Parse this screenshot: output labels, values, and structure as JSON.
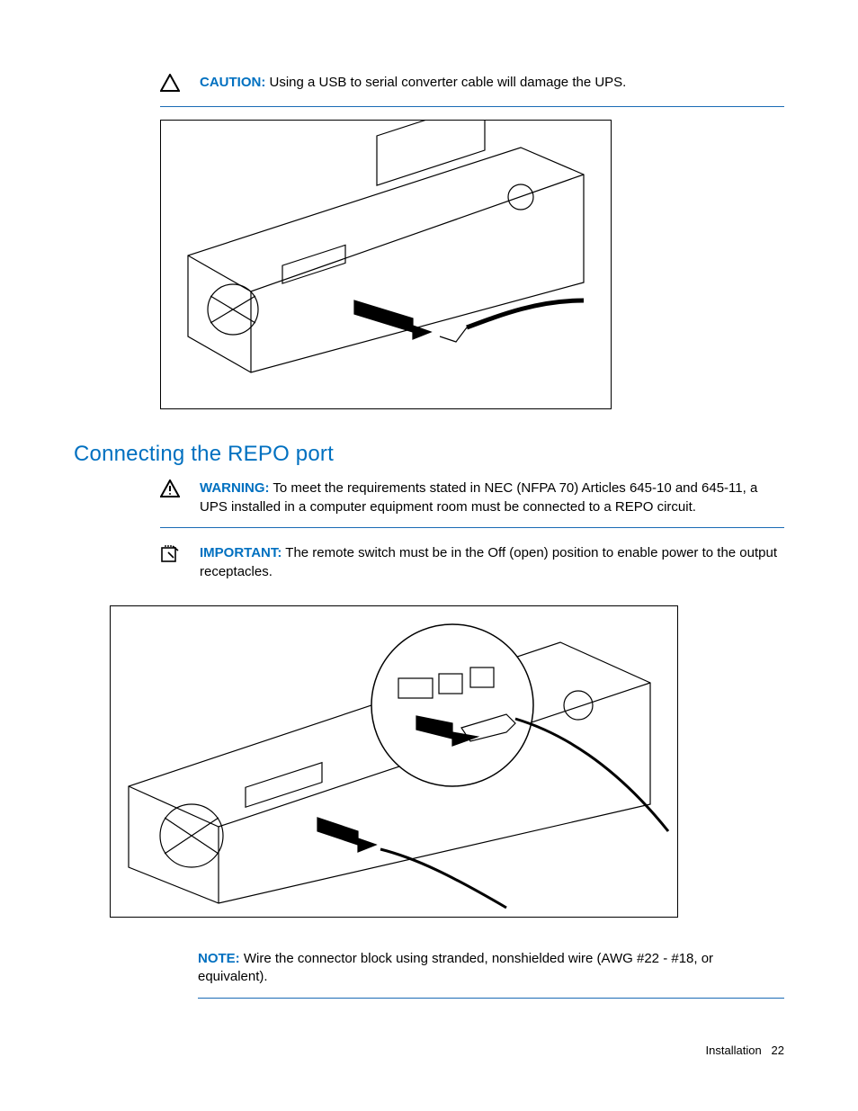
{
  "caution": {
    "label": "CAUTION:",
    "text": "Using a USB to serial converter cable will damage the UPS."
  },
  "heading": "Connecting the REPO port",
  "warning": {
    "label": "WARNING:",
    "text": "To meet the requirements stated in NEC (NFPA 70) Articles 645-10 and 645-11, a UPS installed in a computer equipment room must be connected to a REPO circuit."
  },
  "important": {
    "label": "IMPORTANT:",
    "text": "The remote switch must be in the Off (open) position to enable power to the output receptacles."
  },
  "note": {
    "label": "NOTE:",
    "text": "Wire the connector block using stranded, nonshielded wire (AWG #22 - #18, or equivalent)."
  },
  "footer": {
    "section": "Installation",
    "page": "22"
  }
}
